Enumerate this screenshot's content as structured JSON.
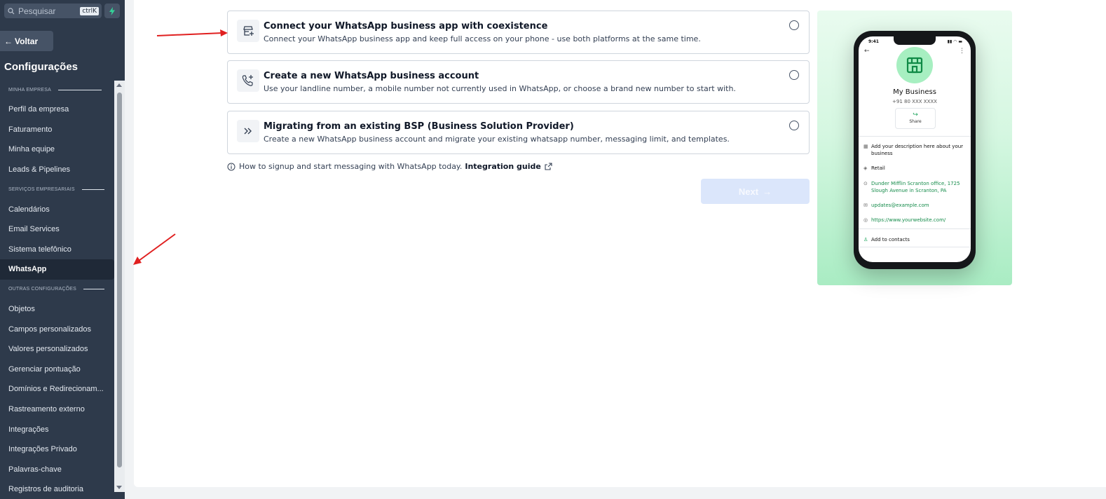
{
  "sidebar": {
    "search_placeholder": "Pesquisar",
    "search_shortcut": "ctrlK",
    "back_label": "Voltar",
    "title": "Configurações",
    "sections": [
      {
        "label": "MINHA EMPRESA",
        "items": [
          "Perfil da empresa",
          "Faturamento",
          "Minha equipe",
          "Leads & Pipelines"
        ]
      },
      {
        "label": "SERVIÇOS EMPRESARIAIS",
        "items": [
          "Calendários",
          "Email Services",
          "Sistema telefônico",
          "WhatsApp"
        ]
      },
      {
        "label": "OUTRAS CONFIGURAÇÕES",
        "items": [
          "Objetos",
          "Campos personalizados",
          "Valores personalizados",
          "Gerenciar pontuação",
          "Domínios e Redirecionam...",
          "Rastreamento externo",
          "Integrações",
          "Integrações Privado",
          "Palavras-chave",
          "Registros de auditoria"
        ]
      }
    ],
    "active_item": "WhatsApp"
  },
  "options": [
    {
      "title": "Connect your WhatsApp business app with coexistence",
      "description": "Connect your WhatsApp business app and keep full access on your phone - use both platforms at the same time.",
      "icon": "store-plus-icon"
    },
    {
      "title": "Create a new WhatsApp business account",
      "description": "Use your landline number, a mobile number not currently used in WhatsApp, or choose a brand new number to start with.",
      "icon": "phone-plus-icon"
    },
    {
      "title": "Migrating from an existing BSP (Business Solution Provider)",
      "description": "Create a new WhatsApp business account and migrate your existing whatsapp number, messaging limit, and templates.",
      "icon": "double-chevron-right-icon"
    }
  ],
  "hint": {
    "text": "How to signup and start messaging with WhatsApp today.",
    "link_label": "Integration guide"
  },
  "next_label": "Next",
  "phone": {
    "time": "9:41",
    "business_name": "My Business",
    "phone_number": "+91 80 XXX XXXX",
    "share_label": "Share",
    "description": "Add your description here about your business",
    "category": "Retail",
    "address": "Dunder Mifflin Scranton office, 1725 Slough Avenue in Scranton, PA",
    "email": "updates@example.com",
    "website": "https://www.yourwebsite.com/",
    "add_contact": "Add to contacts"
  },
  "colors": {
    "sidebar_bg": "#2e3a4b",
    "accent_green": "#1aa35a",
    "next_disabled": "#dbe6fb",
    "annotation_arrow": "#e02020"
  }
}
